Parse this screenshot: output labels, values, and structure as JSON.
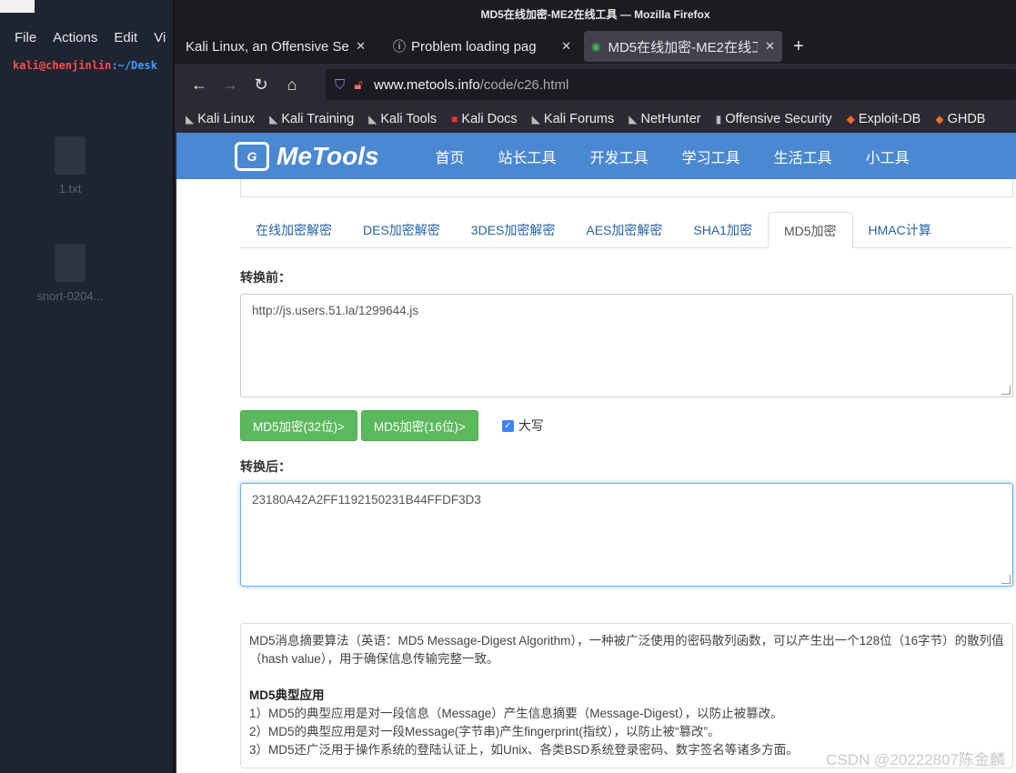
{
  "terminal": {
    "menu": [
      "File",
      "Actions",
      "Edit",
      "Vi"
    ],
    "prompt_user": "kali@chenjinlin",
    "prompt_path": ":~/Desk"
  },
  "desktop": {
    "icons": [
      {
        "label": "1.txt"
      },
      {
        "label": "snort-0204..."
      }
    ]
  },
  "browser": {
    "window_title": "MD5在线加密-ME2在线工具 — Mozilla Firefox",
    "tabs": [
      {
        "label": "Kali Linux, an Offensive Secu",
        "icon": "kali-icon",
        "active": false
      },
      {
        "label": "Problem loading page",
        "icon": "info-icon",
        "active": false
      },
      {
        "label": "MD5在线加密-ME2在线工",
        "icon": "metools-icon",
        "active": true
      }
    ],
    "new_tab": "+",
    "url_domain": "www.metools.info",
    "url_path": "/code/c26.html",
    "bookmarks": [
      "Kali Linux",
      "Kali Training",
      "Kali Tools",
      "Kali Docs",
      "Kali Forums",
      "NetHunter",
      "Offensive Security",
      "Exploit-DB",
      "GHDB"
    ]
  },
  "site": {
    "logo_text": "MeTools",
    "nav": [
      "首页",
      "站长工具",
      "开发工具",
      "学习工具",
      "生活工具",
      "小工具"
    ]
  },
  "tool": {
    "tabs": [
      "在线加密解密",
      "DES加密解密",
      "3DES加密解密",
      "AES加密解密",
      "SHA1加密",
      "MD5加密",
      "HMAC计算"
    ],
    "active_tab": "MD5加密",
    "input_label": "转换前：",
    "input_value": "http://js.users.51.la/1299644.js",
    "btn_32": "MD5加密(32位)>",
    "btn_16": "MD5加密(16位)>",
    "uppercase_label": "大写",
    "uppercase_checked": true,
    "output_label": "转换后：",
    "output_value": "23180A42A2FF1192150231B44FFDF3D3"
  },
  "description": {
    "intro": "MD5消息摘要算法（英语：MD5 Message-Digest Algorithm），一种被广泛使用的密码散列函数，可以产生出一个128位（16字节）的散列值（hash value），用于确保信息传输完整一致。",
    "heading": "MD5典型应用",
    "items": [
      "1）MD5的典型应用是对一段信息（Message）产生信息摘要（Message-Digest），以防止被篡改。",
      "2）MD5的典型应用是对一段Message(字节串)产生fingerprint(指纹），以防止被“篡改”。",
      "3）MD5还广泛用于操作系统的登陆认证上，如Unix、各类BSD系统登录密码、数字签名等诸多方面。"
    ]
  },
  "watermark": "CSDN @20222807陈金麟"
}
